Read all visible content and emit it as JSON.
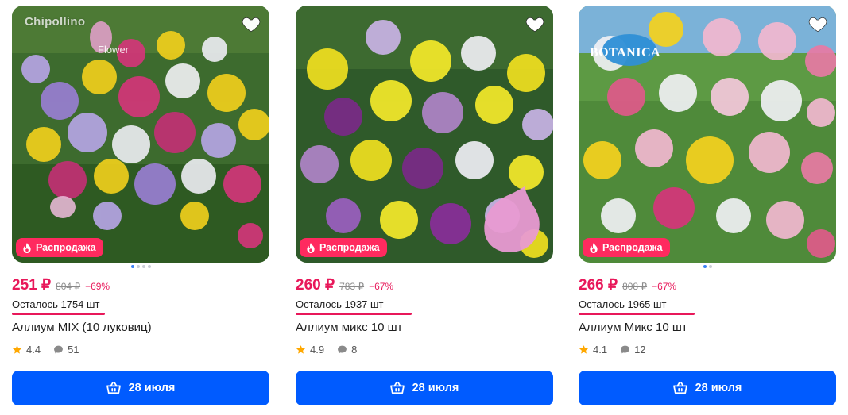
{
  "colors": {
    "accent_pink": "#e8185a",
    "badge_bg": "#ff2a5f",
    "button_blue": "#005bff",
    "star": "#ffa800"
  },
  "products": [
    {
      "brand": "Chipollino",
      "brand_sub": "Flower",
      "badge": "Распродажа",
      "price": "251 ₽",
      "old_price": "804 ₽",
      "discount": "−69%",
      "stock": "Осталось 1754 шт",
      "stock_fraction": 0.36,
      "title": "Аллиум MIX (10 луковиц)",
      "rating": "4.4",
      "reviews": "51",
      "cart_label": "28 июля",
      "carousel": {
        "count": 4,
        "active": 1
      }
    },
    {
      "badge": "Распродажа",
      "price": "260 ₽",
      "old_price": "783 ₽",
      "discount": "−67%",
      "stock": "Осталось 1937 шт",
      "stock_fraction": 0.45,
      "title": "Аллиум микс 10 шт",
      "rating": "4.9",
      "reviews": "8",
      "cart_label": "28 июля"
    },
    {
      "brand": "BOTANICA",
      "badge": "Распродажа",
      "price": "266 ₽",
      "old_price": "808 ₽",
      "discount": "−67%",
      "stock": "Осталось 1965 шт",
      "stock_fraction": 0.45,
      "title": "Аллиум Микс 10 шт",
      "rating": "4.1",
      "reviews": "12",
      "cart_label": "28 июля",
      "carousel": {
        "count": 2,
        "active": 1
      }
    }
  ]
}
